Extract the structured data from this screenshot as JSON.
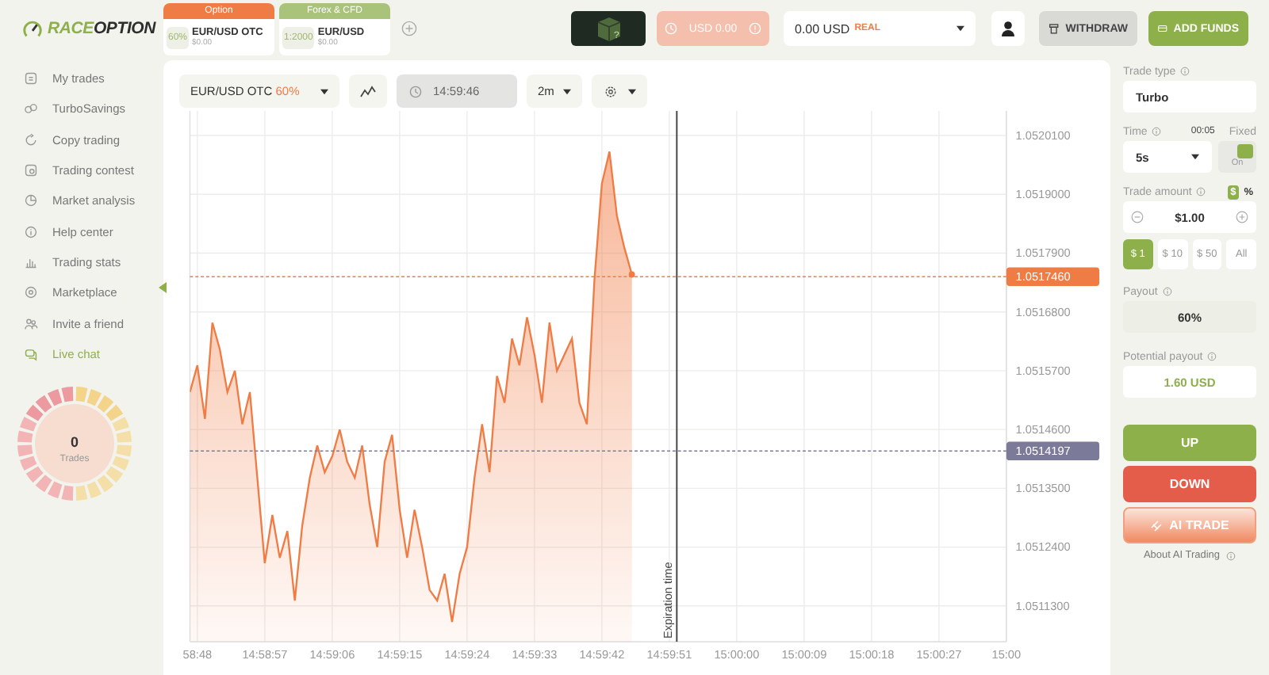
{
  "logo": {
    "accent": "RACE",
    "rest": "OPTION"
  },
  "asset_tabs": [
    {
      "kind": "option",
      "header": "Option",
      "badge": "60%",
      "pair": "EUR/USD OTC",
      "amount": "$0.00"
    },
    {
      "kind": "forex",
      "header": "Forex & CFD",
      "badge": "1:2000",
      "pair": "EUR/USD",
      "amount": "$0.00"
    }
  ],
  "mystery_box": {
    "mark": "?"
  },
  "bonus_button": {
    "label": "USD 0.00",
    "disabled": true
  },
  "balance": {
    "amount": "0.00 USD",
    "account": "REAL"
  },
  "withdraw_button": "WITHDRAW",
  "add_funds_button": "ADD FUNDS",
  "sidebar": {
    "items": [
      {
        "label": "My trades",
        "highlight": false
      },
      {
        "label": "TurboSavings",
        "highlight": false
      },
      {
        "label": "Copy trading",
        "highlight": false
      },
      {
        "label": "Trading contest",
        "highlight": false
      },
      {
        "label": "Market analysis",
        "highlight": false
      },
      {
        "label": "Help center",
        "highlight": false
      },
      {
        "label": "Trading stats",
        "highlight": false
      },
      {
        "label": "Marketplace",
        "highlight": false
      },
      {
        "label": "Invite a friend",
        "highlight": false
      },
      {
        "label": "Live chat",
        "highlight": true
      }
    ],
    "trades_gauge": {
      "count": "0",
      "label": "Trades"
    }
  },
  "toolbar": {
    "payout": "60%",
    "clock": "14:59:46",
    "timeframe": "2m"
  },
  "chart": {
    "chart_data": {
      "type": "area",
      "ylim": [
        1.051063,
        1.052056
      ],
      "categories": [
        null,
        "58:48",
        null,
        null,
        null,
        null,
        null,
        null,
        null,
        null,
        "14:58:57",
        null,
        null,
        null,
        null,
        null,
        null,
        null,
        null,
        "14:59:06",
        null,
        null,
        null,
        null,
        null,
        null,
        null,
        null,
        "14:59:15",
        null,
        null,
        null,
        null,
        null,
        null,
        null,
        null,
        "14:59:24",
        null,
        null,
        null,
        null,
        null,
        null,
        null,
        null,
        "14:59:33",
        null,
        null,
        null,
        null,
        null,
        null,
        null,
        null,
        "14:59:42",
        null,
        null,
        null,
        null,
        null,
        null,
        null,
        null,
        "14:59:51",
        null,
        null,
        null,
        null,
        null,
        null,
        null,
        null,
        "15:00:00",
        null,
        null,
        null,
        null,
        null,
        null,
        null,
        null,
        "15:00:09",
        null,
        null,
        null,
        null,
        null,
        null,
        null,
        null,
        "15:00:18",
        null,
        null,
        null,
        null,
        null,
        null,
        null,
        null,
        "15:00:27",
        null,
        null,
        null,
        null,
        null,
        null,
        null,
        null,
        "15:00"
      ],
      "series": [
        {
          "name": "EUR/USD OTC",
          "color": "#f07c45",
          "values": [
            1.05153,
            1.05158,
            1.05148,
            1.05166,
            1.05161,
            1.05153,
            1.05157,
            1.05147,
            1.05153,
            1.05137,
            1.05121,
            1.0513,
            1.05122,
            1.05127,
            1.05114,
            1.05128,
            1.05137,
            1.05143,
            1.05138,
            1.05141,
            1.05146,
            1.0514,
            1.05137,
            1.05143,
            1.05132,
            1.05124,
            1.0514,
            1.05145,
            1.05131,
            1.05122,
            1.05131,
            1.05124,
            1.05116,
            1.05114,
            1.05119,
            1.0511,
            1.05119,
            1.05124,
            1.05137,
            1.05147,
            1.05138,
            1.05156,
            1.05151,
            1.05163,
            1.05158,
            1.05167,
            1.0516,
            1.05151,
            1.05166,
            1.05157,
            1.0516,
            1.05163,
            1.05151,
            1.05147,
            1.05174,
            1.05192,
            1.05198,
            1.05186,
            1.0518,
            1.05175,
            null,
            null,
            null,
            null,
            null,
            null,
            null,
            null,
            null,
            null,
            null,
            null,
            null,
            null,
            null,
            null,
            null,
            null,
            null,
            null,
            null,
            null,
            null,
            null,
            null,
            null,
            null,
            null,
            null,
            null,
            null,
            null,
            null,
            null,
            null,
            null,
            null,
            null,
            null,
            null,
            null,
            null,
            null,
            null,
            null,
            null,
            null,
            null,
            null,
            null
          ]
        }
      ],
      "yticks": [
        {
          "value": 1.05201,
          "label": "1.0520100"
        },
        {
          "value": 1.0519,
          "label": "1.0519000"
        },
        {
          "value": 1.05179,
          "label": "1.0517900"
        },
        {
          "value": 1.05168,
          "label": "1.0516800"
        },
        {
          "value": 1.05157,
          "label": "1.0515700"
        },
        {
          "value": 1.05146,
          "label": "1.0514600"
        },
        {
          "value": 1.05135,
          "label": "1.0513500"
        },
        {
          "value": 1.05124,
          "label": "1.0512400"
        },
        {
          "value": 1.05113,
          "label": "1.0511300"
        }
      ],
      "grid": true,
      "ref_lines": [
        {
          "axis": "y",
          "value": 1.051746,
          "label": "1.0517460"
        },
        {
          "axis": "y",
          "value": 1.0514197,
          "label": "1.0514197"
        }
      ]
    },
    "expiration_label": "Expiration time"
  },
  "trade_panel": {
    "trade_type_label": "Trade type",
    "trade_type": "Turbo",
    "time_label": "Time",
    "countdown": "00:05",
    "fixed_label": "Fixed",
    "time": "5s",
    "fixed_on": true,
    "fixed_state": "On",
    "amount_label": "Trade amount",
    "units": [
      {
        "label": "$",
        "selected": true
      },
      {
        "label": "%",
        "selected": false
      }
    ],
    "amount": "$1.00",
    "presets": [
      {
        "label": "$ 1",
        "selected": true
      },
      {
        "label": "$ 10",
        "selected": false
      },
      {
        "label": "$ 50",
        "selected": false
      },
      {
        "label": "All",
        "selected": false
      }
    ],
    "payout_label": "Payout",
    "payout": "60%",
    "potential_label": "Potential payout",
    "potential": "1.60 USD",
    "up": "UP",
    "down": "DOWN",
    "ai_trade": "AI TRADE",
    "about_ai": "About AI Trading"
  }
}
